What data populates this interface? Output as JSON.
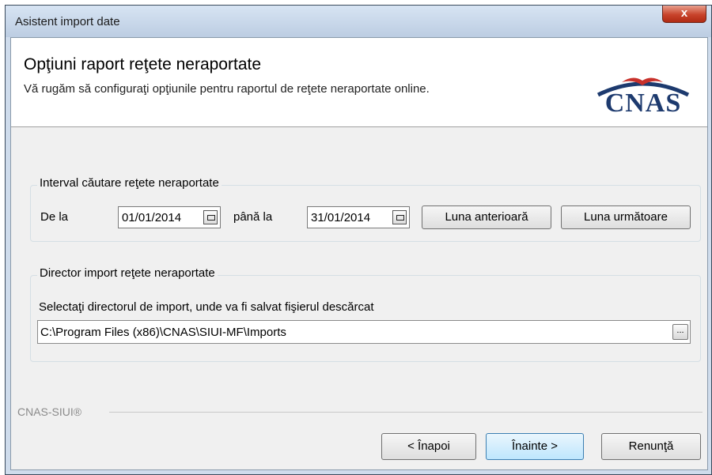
{
  "window": {
    "title": "Asistent import date",
    "close_glyph": "x"
  },
  "header": {
    "title": "Opţiuni raport reţete neraportate",
    "subtitle": "Vă rugăm să configuraţi opţiunile pentru raportul de reţete neraportate online.",
    "logo_text": "CNAS",
    "logo_colors": {
      "bird": "#c8302a",
      "arc": "#1d3a6e"
    }
  },
  "interval": {
    "legend": "Interval căutare reţete neraportate",
    "from_label": "De la",
    "from_value": "01/01/2014",
    "to_label": "până la",
    "to_value": "31/01/2014",
    "prev_month_label": "Luna anterioară",
    "next_month_label": "Luna următoare"
  },
  "directory": {
    "legend": "Director import reţete neraportate",
    "instruction": "Selectaţi directorul de import, unde va fi salvat fişierul descărcat",
    "path": "C:\\Program Files (x86)\\CNAS\\SIUI-MF\\Imports",
    "browse_label": "..."
  },
  "footer": {
    "brand": "CNAS-SIUI®",
    "back_label": "< Înapoi",
    "next_label": "Înainte >",
    "cancel_label": "Renunţă"
  }
}
